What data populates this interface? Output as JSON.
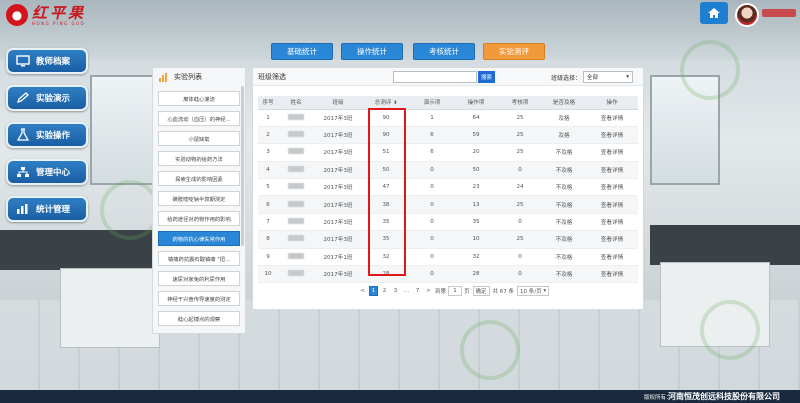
{
  "brand": {
    "name_cn": "红平果",
    "name_en": "HONG PING GUO"
  },
  "nav": [
    {
      "label": "教师档案",
      "icon": "monitor-icon"
    },
    {
      "label": "实验演示",
      "icon": "pen-icon"
    },
    {
      "label": "实验操作",
      "icon": "flask-icon"
    },
    {
      "label": "管理中心",
      "icon": "network-icon"
    },
    {
      "label": "统计管理",
      "icon": "bar-chart-icon"
    }
  ],
  "tabs": [
    {
      "label": "基础统计",
      "active": false
    },
    {
      "label": "操作统计",
      "active": false
    },
    {
      "label": "考核统计",
      "active": false
    },
    {
      "label": "实验测评",
      "active": true
    }
  ],
  "experiment_list": {
    "title": "实验列表",
    "items": [
      "离体蛙心灌流",
      "心血流动（血压）的神经...",
      "小鼠缺氧",
      "实验动物的给药方法",
      "探索生成的影响因素",
      "磺胺嘧啶钠半衰期测定",
      "给药途径对药物作用的影响",
      "药物的抗心律失常作用",
      "镇痛药抗震石酸镇痛 \"扭...",
      "速尿对家兔的利尿作用",
      "神经干兴奋传导速度的测定",
      "蛙心起搏点的观察"
    ],
    "active_index": 7
  },
  "filter": {
    "title": "班级筛选",
    "search_placeholder": "",
    "search_button": "搜索",
    "class_label": "班级选择：",
    "class_value": "全部"
  },
  "table": {
    "headers": [
      "序号",
      "姓名",
      "班级",
      "总测评",
      "演示项",
      "操作项",
      "考核项",
      "是否及格",
      "操作"
    ],
    "rows": [
      {
        "no": "1",
        "class": "2017年3班",
        "total": "90",
        "demo": "1",
        "op": "64",
        "exam": "25",
        "pass": "及格",
        "action": "查看详情"
      },
      {
        "no": "2",
        "class": "2017年3班",
        "total": "90",
        "demo": "6",
        "op": "59",
        "exam": "25",
        "pass": "及格",
        "action": "查看详情"
      },
      {
        "no": "3",
        "class": "2017年3班",
        "total": "51",
        "demo": "6",
        "op": "20",
        "exam": "25",
        "pass": "不及格",
        "action": "查看详情"
      },
      {
        "no": "4",
        "class": "2017年3班",
        "total": "50",
        "demo": "0",
        "op": "50",
        "exam": "0",
        "pass": "不及格",
        "action": "查看详情"
      },
      {
        "no": "5",
        "class": "2017年3班",
        "total": "47",
        "demo": "0",
        "op": "23",
        "exam": "24",
        "pass": "不及格",
        "action": "查看详情"
      },
      {
        "no": "6",
        "class": "2017年3班",
        "total": "38",
        "demo": "0",
        "op": "13",
        "exam": "25",
        "pass": "不及格",
        "action": "查看详情"
      },
      {
        "no": "7",
        "class": "2017年3班",
        "total": "35",
        "demo": "0",
        "op": "35",
        "exam": "0",
        "pass": "不及格",
        "action": "查看详情"
      },
      {
        "no": "8",
        "class": "2017年3班",
        "total": "35",
        "demo": "0",
        "op": "10",
        "exam": "25",
        "pass": "不及格",
        "action": "查看详情"
      },
      {
        "no": "9",
        "class": "2017年1班",
        "total": "32",
        "demo": "0",
        "op": "32",
        "exam": "0",
        "pass": "不及格",
        "action": "查看详情"
      },
      {
        "no": "10",
        "class": "2017年3班",
        "total": "28",
        "demo": "0",
        "op": "28",
        "exam": "0",
        "pass": "不及格",
        "action": "查看详情"
      }
    ]
  },
  "pager": {
    "pages": [
      "1",
      "2",
      "3",
      "...",
      "7"
    ],
    "current": "1",
    "prev": "<",
    "next": ">",
    "goto_prefix": "到第",
    "goto_value": "1",
    "goto_suffix": "页",
    "confirm": "确定",
    "total": "共 67 条",
    "page_size": "10 条/页"
  },
  "footer": {
    "label": "版权所有：",
    "company": "河南恒茂创远科技股份有限公司"
  },
  "colors": {
    "primary": "#2a86d6",
    "active_tab": "#f09a3c",
    "highlight": "#e0181e",
    "footer": "#1a2a3e"
  }
}
